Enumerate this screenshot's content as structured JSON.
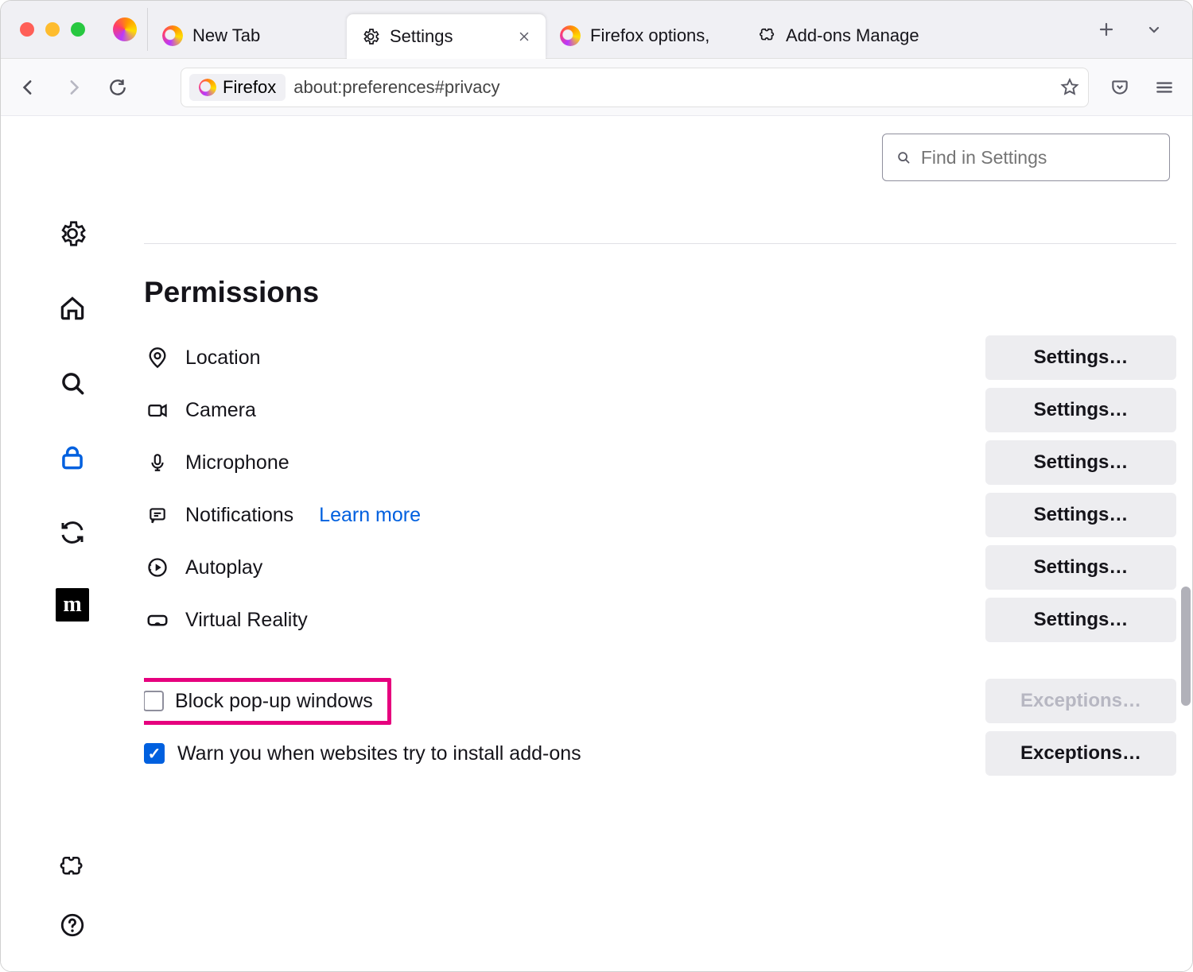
{
  "tabs": [
    {
      "label": "New Tab",
      "icon": "firefox"
    },
    {
      "label": "Settings",
      "icon": "gear",
      "active": true
    },
    {
      "label": "Firefox options,",
      "icon": "firefox"
    },
    {
      "label": "Add-ons Manage",
      "icon": "puzzle"
    }
  ],
  "url": {
    "identity_label": "Firefox",
    "address": "about:preferences#privacy"
  },
  "search": {
    "placeholder": "Find in Settings"
  },
  "section": {
    "title": "Permissions"
  },
  "permissions": [
    {
      "key": "location",
      "label": "Location",
      "icon": "pin",
      "button": "Settings…"
    },
    {
      "key": "camera",
      "label": "Camera",
      "icon": "camera",
      "button": "Settings…"
    },
    {
      "key": "microphone",
      "label": "Microphone",
      "icon": "mic",
      "button": "Settings…"
    },
    {
      "key": "notifications",
      "label": "Notifications",
      "icon": "chat",
      "button": "Settings…",
      "learn_more": "Learn more"
    },
    {
      "key": "autoplay",
      "label": "Autoplay",
      "icon": "play",
      "button": "Settings…"
    },
    {
      "key": "vr",
      "label": "Virtual Reality",
      "icon": "vr",
      "button": "Settings…"
    }
  ],
  "checkboxes": [
    {
      "key": "block_popups",
      "label": "Block pop-up windows",
      "checked": false,
      "button": "Exceptions…",
      "button_disabled": true,
      "highlighted": true
    },
    {
      "key": "warn_addons",
      "label": "Warn you when websites try to install add-ons",
      "checked": true,
      "button": "Exceptions…",
      "button_disabled": false
    }
  ],
  "sidebar": {
    "items": [
      {
        "key": "general",
        "icon": "gear"
      },
      {
        "key": "home",
        "icon": "home"
      },
      {
        "key": "search",
        "icon": "search"
      },
      {
        "key": "privacy",
        "icon": "lock",
        "active": true
      },
      {
        "key": "sync",
        "icon": "sync"
      },
      {
        "key": "mozilla",
        "icon": "m",
        "label": "m"
      }
    ],
    "bottom": [
      {
        "key": "extensions",
        "icon": "puzzle"
      },
      {
        "key": "help",
        "icon": "help"
      }
    ]
  }
}
